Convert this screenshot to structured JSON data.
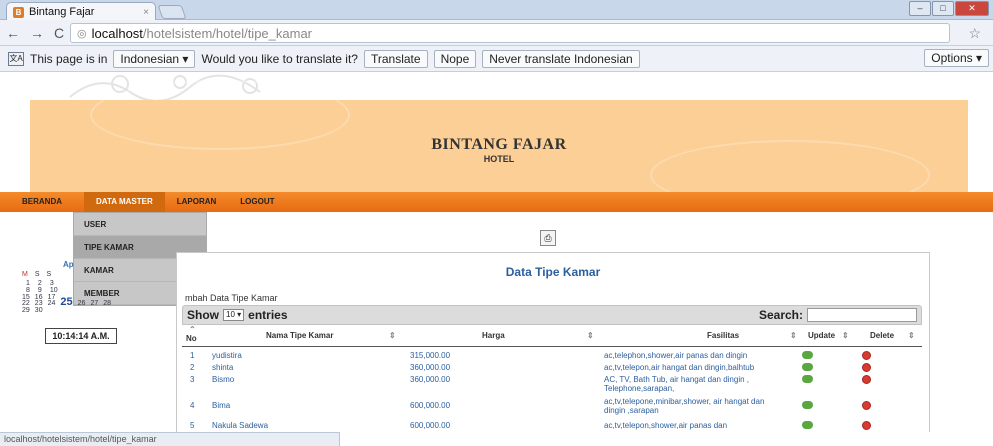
{
  "browser": {
    "tab_title": "Bintang Fajar",
    "tab_close": "×",
    "url_host": "localhost",
    "url_path": "/hotelsistem/hotel/tipe_kamar",
    "status_url": "localhost/hotelsistem/hotel/tipe_kamar"
  },
  "translate": {
    "icon": "文A",
    "prefix": "This page is in",
    "language": "Indonesian ▾",
    "question": "Would you like to translate it?",
    "translate_btn": "Translate",
    "nope_btn": "Nope",
    "never_btn": "Never translate Indonesian",
    "options_btn": "Options ▾"
  },
  "brand": {
    "title": "BINTANG FAJAR",
    "subtitle": "HOTEL"
  },
  "menu": {
    "items": [
      "BERANDA",
      "DATA MASTER",
      "LAPORAN",
      "LOGOUT"
    ],
    "active": "DATA MASTER"
  },
  "dropdown": {
    "items": [
      "USER",
      "TIPE KAMAR",
      "KAMAR",
      "MEMBER"
    ],
    "highlighted": "TIPE KAMAR"
  },
  "calendar": {
    "month_label": "Ap",
    "day_headers": [
      "M",
      "S",
      "S"
    ],
    "rows": [
      [
        "1",
        "2",
        "3"
      ],
      [
        "8",
        "9",
        "10"
      ],
      [
        "15",
        "16",
        "17"
      ],
      [
        "22",
        "23",
        "24",
        "25",
        "26",
        "27",
        "28"
      ],
      [
        "29",
        "30"
      ]
    ],
    "today": "25",
    "clock": "10:14:14 A.M."
  },
  "panel": {
    "title": "Data Tipe Kamar",
    "add_link": "mbah Data Tipe Kamar",
    "show": "Show",
    "entries_value": "10",
    "entries": "entries",
    "search": "Search:"
  },
  "table": {
    "headers": [
      "No",
      "Nama Tipe Kamar",
      "Harga",
      "Fasilitas",
      "Update",
      "Delete"
    ],
    "rows": [
      {
        "no": "1",
        "nama": "yudistira",
        "harga": "315,000.00",
        "fasilitas": "ac,telephon,shower,air panas dan dingin"
      },
      {
        "no": "2",
        "nama": "shinta",
        "harga": "360,000.00",
        "fasilitas": "ac,tv,telepon,air hangat dan dingin,balhtub"
      },
      {
        "no": "3",
        "nama": "Bismo",
        "harga": "360,000.00",
        "fasilitas": "AC, TV, Bath Tub, air hangat dan dingin , Telephone,sarapan,"
      },
      {
        "no": "4",
        "nama": "Bima",
        "harga": "600,000.00",
        "fasilitas": "ac,tv,telepone,minibar,shower, air hangat dan dingin ,sarapan"
      },
      {
        "no": "5",
        "nama": "Nakula Sadewa",
        "harga": "600,000.00",
        "fasilitas": "ac,tv,telepon,shower,air panas dan"
      }
    ]
  },
  "colors": {
    "banner": "#fbcf96",
    "menubar": "#ef7a1c",
    "link": "#2c5f9e"
  }
}
